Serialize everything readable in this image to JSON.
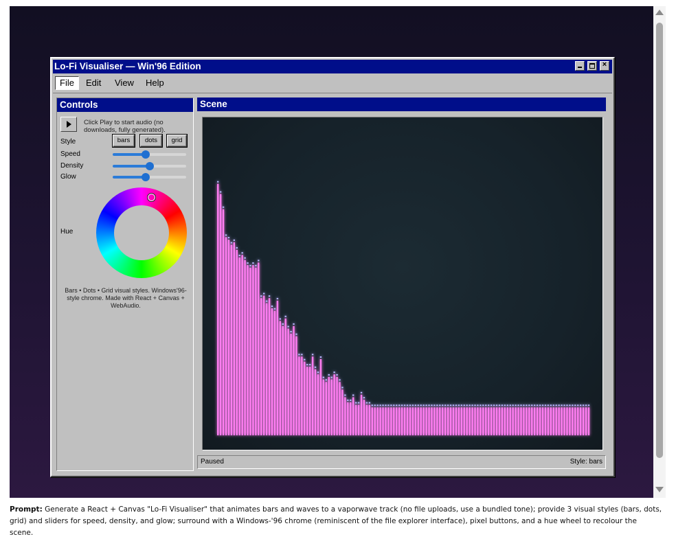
{
  "window": {
    "title": "Lo-Fi Visualiser — Win'96 Edition"
  },
  "menu": {
    "items": [
      "File",
      "Edit",
      "View",
      "Help"
    ],
    "active": "File"
  },
  "controls": {
    "title": "Controls",
    "hint": "Click Play to start audio (no downloads, fully generated).",
    "style_label": "Style",
    "style_buttons": [
      "bars",
      "dots",
      "grid"
    ],
    "sliders": [
      {
        "label": "Speed",
        "value": 0.45
      },
      {
        "label": "Density",
        "value": 0.5
      },
      {
        "label": "Glow",
        "value": 0.45
      }
    ],
    "hue_label": "Hue",
    "footer": "Bars • Dots • Grid visual styles. Windows'96-style chrome. Made with React + Canvas + WebAudio."
  },
  "scene": {
    "title": "Scene",
    "status": "Paused",
    "style_status": "Style: bars",
    "bar_color": "#ff7ef2",
    "bar_cap_color": "#b9b6ff",
    "bars": [
      0.99,
      0.95,
      0.89,
      0.78,
      0.77,
      0.75,
      0.76,
      0.73,
      0.7,
      0.71,
      0.69,
      0.67,
      0.66,
      0.67,
      0.66,
      0.68,
      0.54,
      0.55,
      0.52,
      0.54,
      0.5,
      0.49,
      0.53,
      0.45,
      0.43,
      0.46,
      0.42,
      0.4,
      0.43,
      0.39,
      0.31,
      0.31,
      0.29,
      0.27,
      0.27,
      0.31,
      0.26,
      0.24,
      0.3,
      0.22,
      0.21,
      0.23,
      0.22,
      0.24,
      0.23,
      0.21,
      0.18,
      0.15,
      0.13,
      0.13,
      0.15,
      0.12,
      0.12,
      0.16,
      0.14,
      0.12,
      0.12,
      0.11,
      0.11,
      0.11,
      0.11,
      0.11,
      0.11,
      0.11,
      0.11,
      0.11,
      0.11,
      0.11,
      0.11,
      0.11,
      0.11,
      0.11,
      0.11,
      0.11,
      0.11,
      0.11,
      0.11,
      0.11,
      0.11,
      0.11,
      0.11,
      0.11,
      0.11,
      0.11,
      0.11,
      0.11,
      0.11,
      0.11,
      0.11,
      0.11,
      0.11,
      0.11,
      0.11,
      0.11,
      0.11,
      0.11,
      0.11,
      0.11,
      0.11,
      0.11,
      0.11,
      0.11,
      0.11,
      0.11,
      0.11,
      0.11,
      0.11,
      0.11,
      0.11,
      0.11,
      0.11,
      0.11,
      0.11,
      0.11,
      0.11,
      0.11,
      0.11,
      0.11,
      0.11,
      0.11,
      0.11,
      0.11,
      0.11,
      0.11,
      0.11,
      0.11,
      0.11,
      0.11,
      0.11,
      0.11,
      0.11,
      0.11,
      0.11,
      0.11,
      0.11,
      0.11,
      0.11,
      0.11
    ]
  },
  "prompt": {
    "label": "Prompt:",
    "text": " Generate a React + Canvas \"Lo-Fi Visualiser\" that animates bars and waves to a vaporwave track (no file uploads, use a bundled tone); provide 3 visual styles (bars, dots, grid) and sliders for speed, density, and glow; surround with a Windows-'96 chrome (reminiscent of the file explorer interface), pixel buttons, and a hue wheel to recolour the scene."
  }
}
